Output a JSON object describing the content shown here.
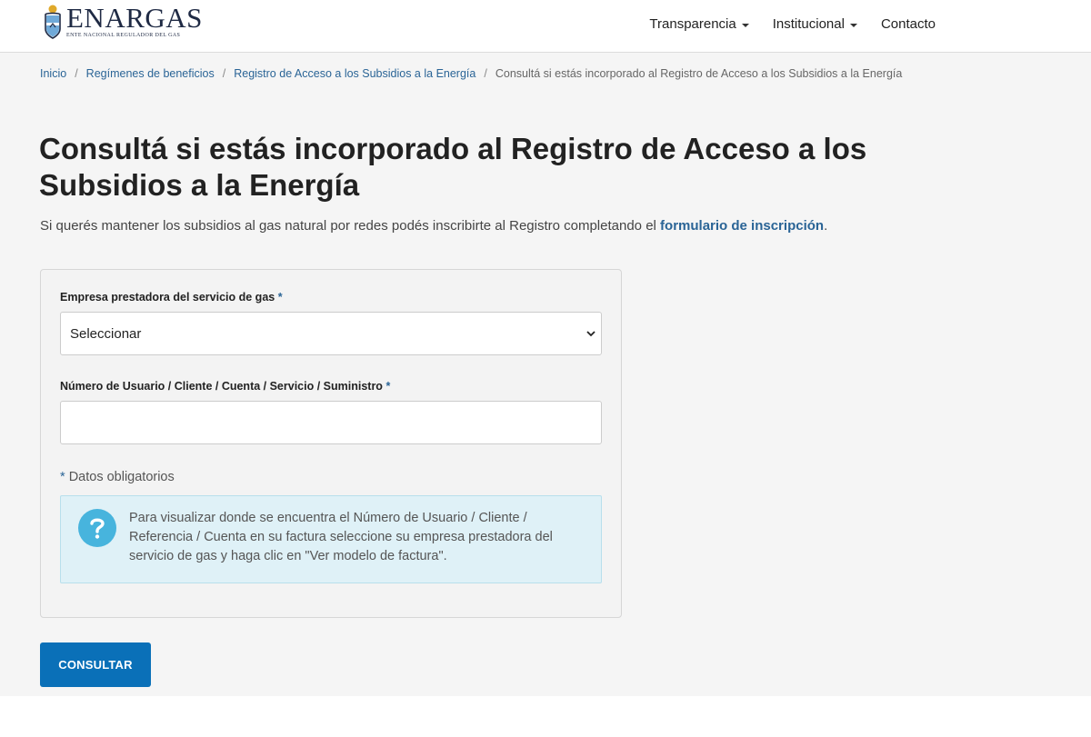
{
  "brand": {
    "name": "ENARGAS",
    "tagline": "ENTE NACIONAL REGULADOR DEL GAS"
  },
  "nav": {
    "items": [
      {
        "label": "Transparencia",
        "dropdown": true
      },
      {
        "label": "Institucional",
        "dropdown": true
      },
      {
        "label": "Contacto",
        "dropdown": false
      }
    ]
  },
  "breadcrumb": {
    "items": [
      "Inicio",
      "Regímenes de beneficios",
      "Registro de Acceso a los Subsidios a la Energía"
    ],
    "current": "Consultá si estás incorporado al Registro de Acceso a los Subsidios a la Energía",
    "separator": "/"
  },
  "page": {
    "title": "Consultá si estás incorporado al Registro de Acceso a los Subsidios a la Energía",
    "lead_text": "Si querés mantener los subsidios al gas natural por redes podés inscribirte al Registro completando el ",
    "lead_link": "formulario de inscripción",
    "lead_end": "."
  },
  "form": {
    "company_label": "Empresa prestadora del servicio de gas",
    "company_selected": "Seleccionar",
    "account_label": "Número de Usuario / Cliente / Cuenta / Servicio / Suministro",
    "account_value": "",
    "required_marker": "*",
    "required_note": "Datos obligatorios",
    "info_text": "Para visualizar donde se encuentra el Número de Usuario / Cliente / Referencia / Cuenta en su factura seleccione su empresa prestadora del servicio de gas y haga clic en \"Ver modelo de factura\".",
    "info_icon": "question-icon",
    "submit_label": "CONSULTAR"
  },
  "colors": {
    "link": "#2a6496",
    "button": "#0a70b8",
    "info_bg": "#dff1f7",
    "info_icon": "#47b4dd",
    "content_bg": "#f5f5f5"
  }
}
